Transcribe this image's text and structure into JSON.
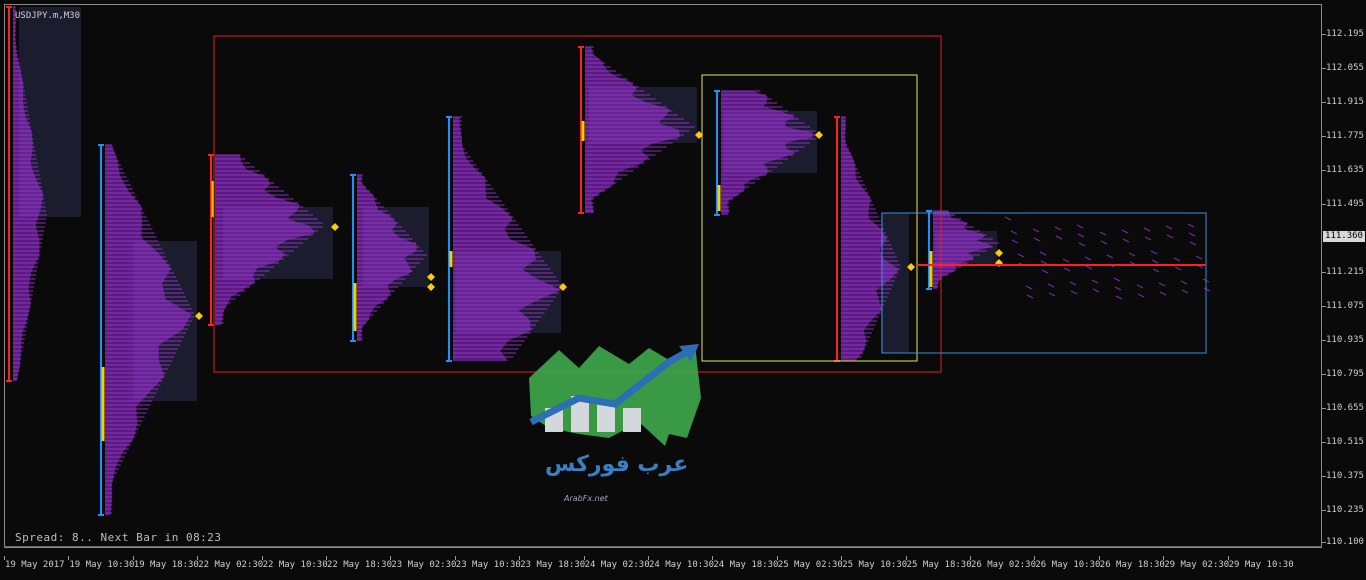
{
  "window": {
    "symbol": "USDJPY.m,M30"
  },
  "status": {
    "spread_text": "Spread: 8.. Next Bar in 08:23"
  },
  "price_axis": {
    "labels": [
      "112.195",
      "112.055",
      "111.915",
      "111.775",
      "111.635",
      "111.495",
      "111.215",
      "111.075",
      "110.935",
      "110.795",
      "110.655",
      "110.515",
      "110.375",
      "110.235",
      "110.100"
    ],
    "current": "111.360"
  },
  "time_axis": {
    "labels": [
      "19 May 2017",
      "19 May 10:30",
      "19 May 18:30",
      "22 May 02:30",
      "22 May 10:30",
      "22 May 18:30",
      "23 May 02:30",
      "23 May 10:30",
      "23 May 18:30",
      "24 May 02:30",
      "24 May 10:30",
      "24 May 18:30",
      "25 May 02:30",
      "25 May 10:30",
      "25 May 18:30",
      "26 May 02:30",
      "26 May 10:30",
      "26 May 18:30",
      "29 May 02:30",
      "29 May 10:30"
    ]
  },
  "watermark": {
    "arabic": "عرب فوركس",
    "url": "ArabFx.net"
  },
  "colors": {
    "background": "#0a0a0a",
    "profile": "#9b30d8",
    "value_area": "#1b1d2e",
    "poc": "#ffcc00",
    "range_up": "#1e90ff",
    "range_down": "#ff2020",
    "box_red": "#e02020",
    "box_yellow": "#e8e060",
    "box_blue": "#3a8fe0"
  }
}
